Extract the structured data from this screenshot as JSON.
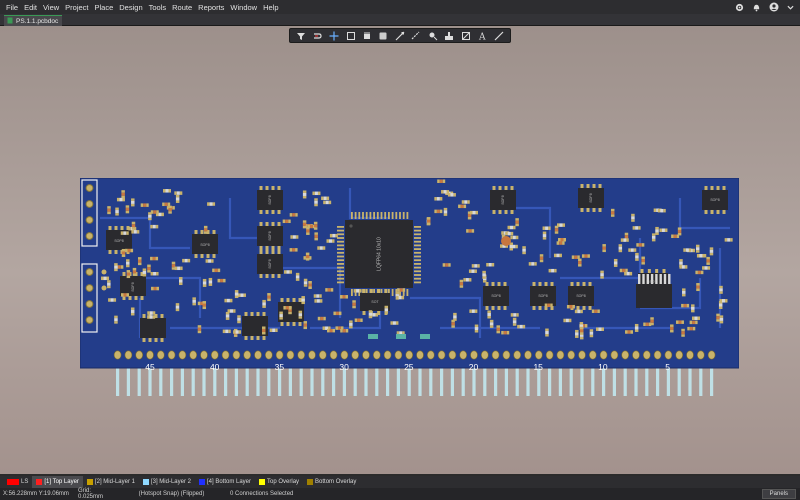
{
  "menu": [
    "File",
    "Edit",
    "View",
    "Project",
    "Place",
    "Design",
    "Tools",
    "Route",
    "Reports",
    "Window",
    "Help"
  ],
  "icons": [
    "gear-icon",
    "bell-icon",
    "user-icon",
    "chevron-down-icon"
  ],
  "document_tab": {
    "label": "PS.1.1.pcbdoc"
  },
  "toolbar_icons": [
    "filter-icon",
    "route-icon",
    "crosshair-icon",
    "rectangle-select-icon",
    "component-icon",
    "region-icon",
    "interactive-route-icon",
    "via-icon",
    "pad-icon",
    "copper-icon",
    "polygon-icon",
    "text-icon",
    "line-icon"
  ],
  "board": {
    "silkscreen_numbers": [
      "45",
      "40",
      "35",
      "30",
      "25",
      "20",
      "15",
      "10",
      "5"
    ],
    "chip_labels": [
      "LQFP64 10x10",
      "SOP8",
      "SOP8",
      "SOP8",
      "SOP8",
      "SOP8",
      "SOP8",
      "SOP8",
      "SOP8",
      "SOP8",
      "SOP8",
      "SOP8",
      "SOP8",
      "SOT",
      "SOT"
    ],
    "colors": {
      "board": "#233d8a",
      "pad": "#c9b36b",
      "pin": "#bfe0e6",
      "body": "#2a2a2e"
    }
  },
  "layers": [
    {
      "name": "LS",
      "color": "#ff0000"
    },
    {
      "name": "[1] Top Layer",
      "color": "#ff2020",
      "active": true
    },
    {
      "name": "[2] Mid-Layer 1",
      "color": "#c8a000"
    },
    {
      "name": "[3] Mid-Layer 2",
      "color": "#8fd8ff"
    },
    {
      "name": "[4] Bottom Layer",
      "color": "#2030ff"
    },
    {
      "name": "Top Overlay",
      "color": "#ffff00"
    },
    {
      "name": "Bottom Overlay",
      "color": "#a08000"
    }
  ],
  "status": {
    "coords": "X:56.228mm Y:19.06mm",
    "grid": "Grid: 0.025mm",
    "snap": "(Hotspot Snap) (Flipped)",
    "selection": "0 Connections Selected",
    "panels": "Panels"
  }
}
